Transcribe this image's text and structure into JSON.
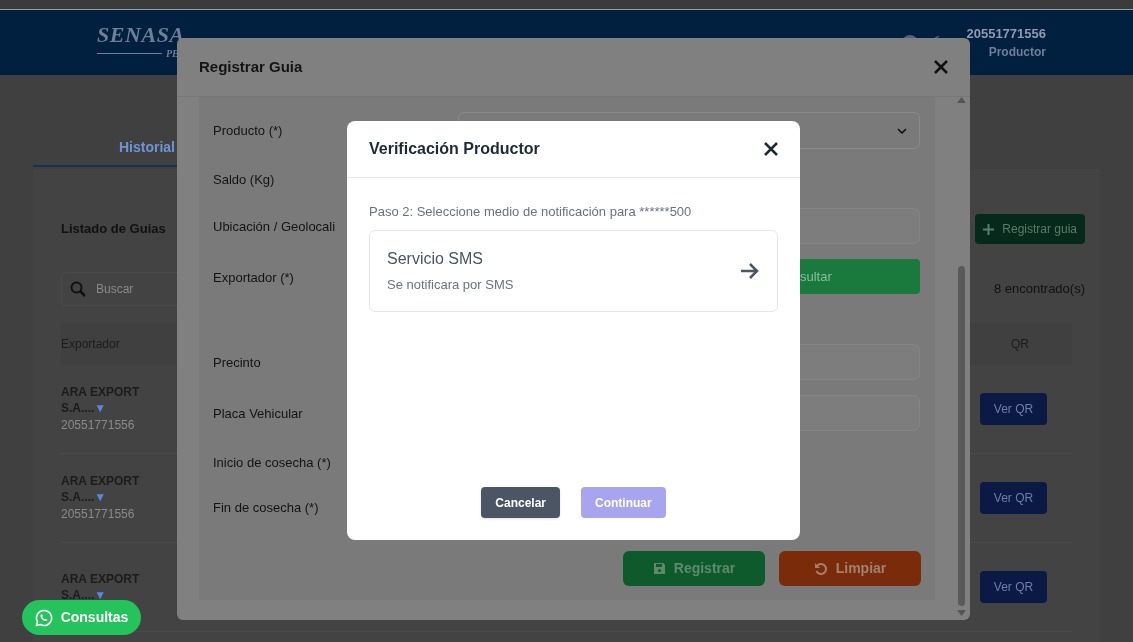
{
  "header": {
    "logo": "SENASA",
    "logo_sub": "PE",
    "user_id": "20551771556",
    "role": "Productor"
  },
  "tabs": [
    {
      "label": "Historial",
      "selected": true
    }
  ],
  "list": {
    "title": "Listado de Guias",
    "register_button": "Registrar guia",
    "search": {
      "placeholder": "Buscar"
    },
    "count": "8 encontrado(s)",
    "columns": [
      "Exportador",
      "QR"
    ],
    "rows": [
      {
        "exporter": "ARA EXPORT S.A....",
        "toggle": "▼",
        "ruc": "20551771556",
        "qr_button": "Ver QR"
      },
      {
        "exporter": "ARA EXPORT S.A....",
        "toggle": "▼",
        "ruc": "20551771556",
        "qr_button": "Ver QR"
      },
      {
        "exporter": "ARA EXPORT S.A....",
        "toggle": "▼",
        "qr_button": "Ver QR"
      }
    ]
  },
  "register_modal": {
    "title": "Registrar Guia",
    "fields": [
      {
        "label": "Producto (*)",
        "kind": "select"
      },
      {
        "label": "Saldo (Kg)",
        "kind": "none"
      },
      {
        "label": "Ubicación / Geolocali",
        "kind": "input"
      },
      {
        "label": "Exportador (*)",
        "kind": "button",
        "button": "sultar"
      },
      {
        "label": "Precinto",
        "kind": "input"
      },
      {
        "label": "Placa Vehicular",
        "kind": "input"
      },
      {
        "label": "Inicio de cosecha (*)",
        "kind": "none"
      },
      {
        "label": "Fin de cosecha (*)",
        "kind": "none"
      }
    ],
    "actions": [
      {
        "label": "Registrar",
        "kind": "save"
      },
      {
        "label": "Limpiar",
        "kind": "reset"
      }
    ]
  },
  "verification_dialog": {
    "title": "Verificación Productor",
    "step": "Paso 2: Seleccione medio de notificación para ******500",
    "options": [
      {
        "title": "Servicio SMS",
        "description": "Se notificara por SMS"
      }
    ],
    "buttons": [
      {
        "label": "Cancelar",
        "kind": "secondary",
        "disabled": false
      },
      {
        "label": "Continuar",
        "kind": "primary",
        "disabled": true
      }
    ]
  },
  "chat_button": {
    "label": "Consultas"
  }
}
